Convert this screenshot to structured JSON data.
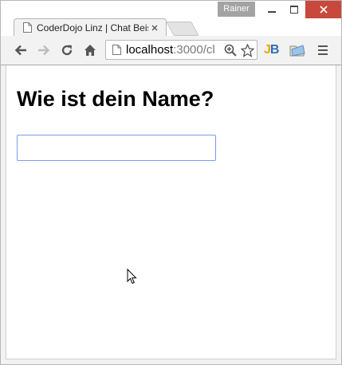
{
  "window": {
    "profile_name": "Rainer",
    "controls": {
      "minimize": "minimize-icon",
      "maximize": "maximize-icon",
      "close": "close-icon"
    }
  },
  "tab": {
    "title": "CoderDojo Linz | Chat Beispiel",
    "favicon": "page-icon",
    "close_icon": "close-icon"
  },
  "toolbar": {
    "back": "arrow-left-icon",
    "forward": "arrow-right-icon",
    "reload": "reload-icon",
    "home": "home-icon",
    "url_host": "localhost",
    "url_rest": ":3000/cl",
    "zoom": "zoom-icon",
    "bookmark": "star-icon",
    "extension_jb": {
      "j": "J",
      "b": "B"
    },
    "extension_folder": "folder-icon",
    "menu": "hamburger-menu-icon"
  },
  "page": {
    "heading": "Wie ist dein Name?",
    "name_input": {
      "value": "",
      "placeholder": ""
    }
  },
  "colors": {
    "close_button": "#c9483c",
    "input_focus_border": "#7a9ce6",
    "jb_orange": "#f0a30a",
    "jb_blue": "#2d6fb7"
  }
}
